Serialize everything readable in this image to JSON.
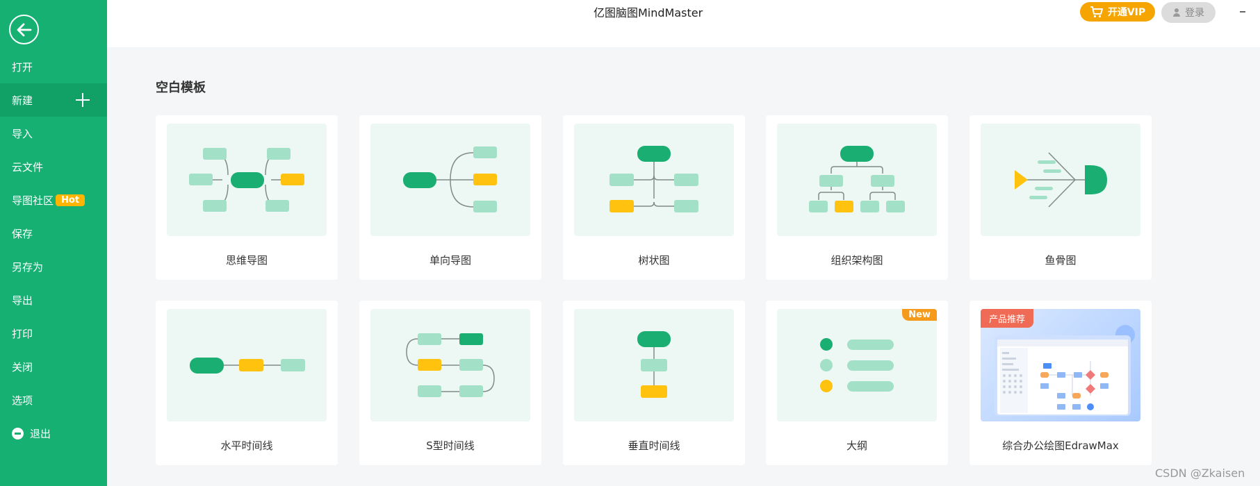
{
  "sidebar": {
    "items": [
      {
        "label": "打开"
      },
      {
        "label": "新建"
      },
      {
        "label": "导入"
      },
      {
        "label": "云文件"
      },
      {
        "label": "导图社区",
        "badge": "Hot"
      },
      {
        "label": "保存"
      },
      {
        "label": "另存为"
      },
      {
        "label": "导出"
      },
      {
        "label": "打印"
      },
      {
        "label": "关闭"
      },
      {
        "label": "选项"
      },
      {
        "label": "退出"
      }
    ]
  },
  "header": {
    "title": "亿图脑图MindMaster",
    "vip_label": "开通VIP",
    "login_label": "登录"
  },
  "main": {
    "section_title": "空白模板",
    "templates": [
      {
        "label": "思维导图"
      },
      {
        "label": "单向导图"
      },
      {
        "label": "树状图"
      },
      {
        "label": "组织架构图"
      },
      {
        "label": "鱼骨图"
      },
      {
        "label": "水平时间线"
      },
      {
        "label": "S型时间线"
      },
      {
        "label": "垂直时间线"
      },
      {
        "label": "大纲",
        "badge": "New"
      },
      {
        "label": "综合办公绘图EdrawMax",
        "badge": "产品推荐"
      }
    ]
  },
  "watermark": "CSDN @Zkaisen",
  "colors": {
    "sidebar": "#15b072",
    "node_dark": "#1aae73",
    "node_light": "#a3e0c8",
    "node_accent": "#ffc20e",
    "vip": "#f6a400"
  }
}
